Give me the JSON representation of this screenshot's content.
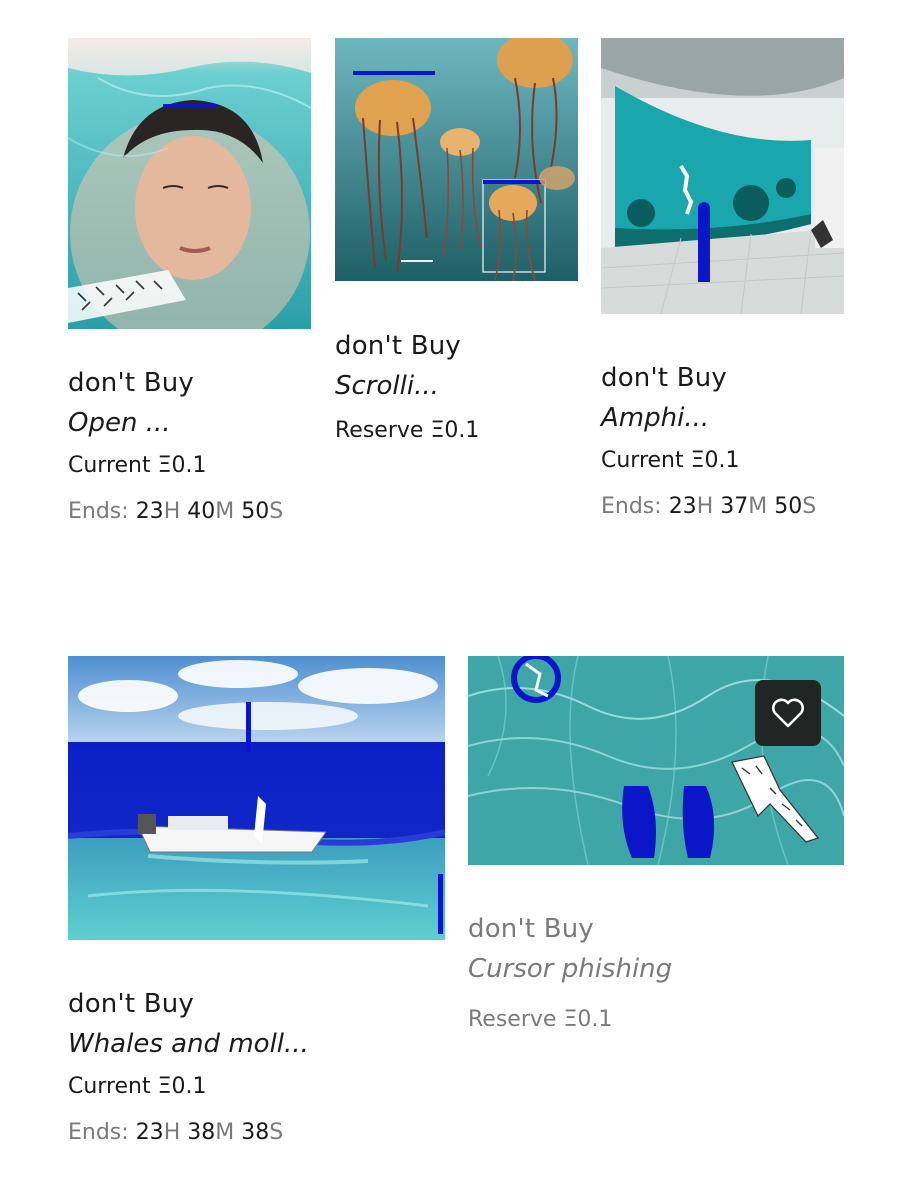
{
  "cards": [
    {
      "artist": "don't Buy",
      "title": "Open ...",
      "price_label": "Current",
      "price": "Ξ0.1",
      "ends": {
        "label": "Ends:",
        "h": "23",
        "h_unit": "H",
        "m": "40",
        "m_unit": "M",
        "s": "50",
        "s_unit": "S"
      }
    },
    {
      "artist": "don't Buy",
      "title": "Scrolli...",
      "price_label": "Reserve",
      "price": "Ξ0.1"
    },
    {
      "artist": "don't Buy",
      "title": "Amphi...",
      "price_label": "Current",
      "price": "Ξ0.1",
      "ends": {
        "label": "Ends:",
        "h": "23",
        "h_unit": "H",
        "m": "37",
        "m_unit": "M",
        "s": "50",
        "s_unit": "S"
      }
    },
    {
      "artist": "don't Buy",
      "title": "Whales and moll...",
      "price_label": "Current",
      "price": "Ξ0.1",
      "ends": {
        "label": "Ends:",
        "h": "23",
        "h_unit": "H",
        "m": "38",
        "m_unit": "M",
        "s": "38",
        "s_unit": "S"
      }
    },
    {
      "artist": "don't Buy",
      "title": "Cursor phishing",
      "price_label": "Reserve",
      "price": "Ξ0.1"
    }
  ],
  "icons": {
    "favorite": "heart-icon"
  },
  "colors": {
    "text": "#1a1a1a",
    "muted": "#7a7a7a",
    "water": "#3fb2b5",
    "glitch_blue": "#0a16c8"
  }
}
